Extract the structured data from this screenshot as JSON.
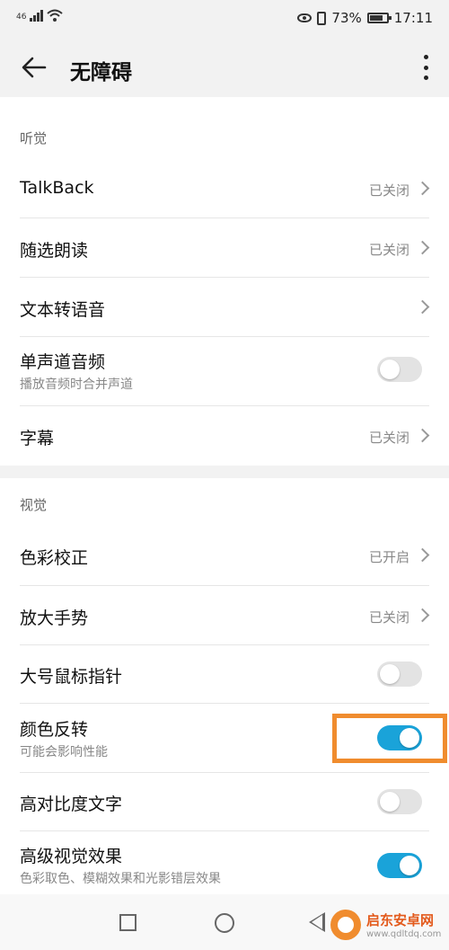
{
  "status_bar": {
    "network": "46",
    "battery": "73%",
    "time": "17:11"
  },
  "app_bar": {
    "title": "无障碍"
  },
  "sections": {
    "hearing": {
      "label": "听觉",
      "items": [
        {
          "label": "TalkBack",
          "value": "已关闭"
        },
        {
          "label": "随选朗读",
          "value": "已关闭"
        },
        {
          "label": "文本转语音"
        },
        {
          "label": "单声道音频",
          "sub": "播放音频时合并声道",
          "toggle": false
        },
        {
          "label": "字幕",
          "value": "已关闭"
        }
      ]
    },
    "vision": {
      "label": "视觉",
      "items": [
        {
          "label": "色彩校正",
          "value": "已开启"
        },
        {
          "label": "放大手势",
          "value": "已关闭"
        },
        {
          "label": "大号鼠标指针",
          "toggle": false
        },
        {
          "label": "颜色反转",
          "sub": "可能会影响性能",
          "toggle": true
        },
        {
          "label": "高对比度文字",
          "toggle": false
        },
        {
          "label": "高级视觉效果",
          "sub": "色彩取色、模糊效果和光影错层效果",
          "toggle": true
        }
      ]
    }
  },
  "watermark": {
    "title": "启东安卓网",
    "url": "www.qdltdq.com"
  },
  "colors": {
    "accent": "#1aa3d9",
    "highlight": "#f08c2e"
  }
}
